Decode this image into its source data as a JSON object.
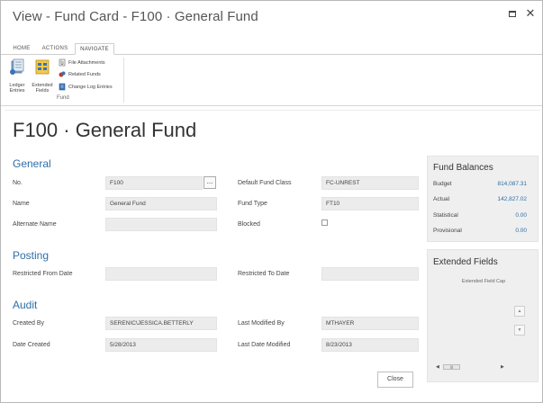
{
  "window": {
    "title": "View - Fund Card - F100 · General Fund",
    "max_icon": "maximize-icon",
    "close_glyph": "✕"
  },
  "ribbon": {
    "tabs": [
      {
        "label": "HOME"
      },
      {
        "label": "ACTIONS"
      },
      {
        "label": "NAVIGATE"
      }
    ],
    "large_buttons": [
      {
        "label": "Ledger Entries",
        "icon": "ledger-icon"
      },
      {
        "label": "Extended Fields",
        "icon": "extended-fields-icon"
      }
    ],
    "small_buttons": [
      {
        "label": "File Attachments",
        "icon": "paperclip-icon"
      },
      {
        "label": "Related Funds",
        "icon": "related-funds-icon"
      },
      {
        "label": "Change Log Entries",
        "icon": "change-log-icon"
      }
    ],
    "group_label": "Fund"
  },
  "page": {
    "title": "F100 · General Fund"
  },
  "general": {
    "heading": "General",
    "no_label": "No.",
    "no_value": "F100",
    "assist_label": "...",
    "name_label": "Name",
    "name_value": "General Fund",
    "alt_name_label": "Alternate Name",
    "alt_name_value": "",
    "default_class_label": "Default Fund Class",
    "default_class_value": "FC-UNREST",
    "fund_type_label": "Fund Type",
    "fund_type_value": "FT10",
    "blocked_label": "Blocked"
  },
  "posting": {
    "heading": "Posting",
    "restricted_from_label": "Restricted From Date",
    "restricted_from_value": "",
    "restricted_to_label": "Restricted To Date",
    "restricted_to_value": ""
  },
  "audit": {
    "heading": "Audit",
    "created_by_label": "Created By",
    "created_by_value": "SERENIC\\JESSICA.BETTERLY",
    "date_created_label": "Date Created",
    "date_created_value": "5/28/2013",
    "last_modified_by_label": "Last Modified By",
    "last_modified_by_value": "MTHAYER",
    "last_date_modified_label": "Last Date Modified",
    "last_date_modified_value": "8/23/2013"
  },
  "fund_balances": {
    "title": "Fund Balances",
    "rows": [
      {
        "label": "Budget",
        "value": "814,087.31"
      },
      {
        "label": "Actual",
        "value": "142,827.02"
      },
      {
        "label": "Statistical",
        "value": "0.00"
      },
      {
        "label": "Provisional",
        "value": "0.00"
      }
    ]
  },
  "extended_fields": {
    "title": "Extended Fields",
    "column_header": "Extended Field Cap",
    "scroll_up_icon": "scroll-up-icon",
    "scroll_down_icon": "scroll-down-icon",
    "hscroll_left": "◀",
    "hscroll_right": "▶",
    "hscroll_thumb": "|||"
  },
  "footer": {
    "close_label": "Close"
  },
  "colors": {
    "accent": "#2f6ea8",
    "factbox_bg": "#efefef",
    "field_bg": "#ececec"
  }
}
